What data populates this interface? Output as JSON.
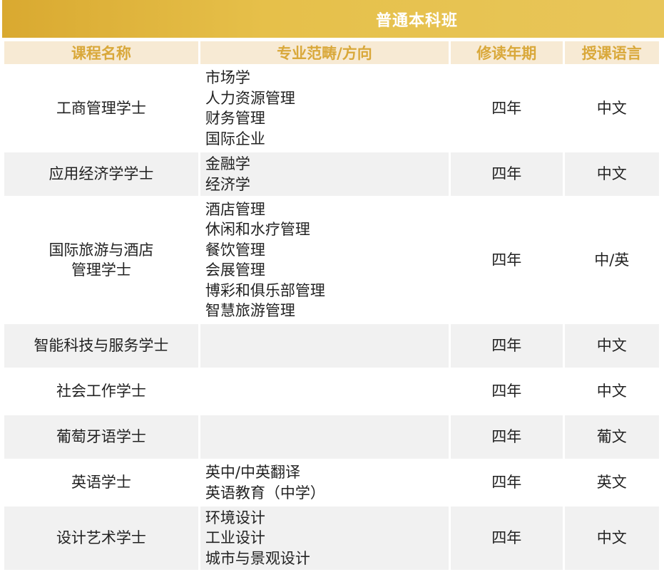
{
  "banner": {
    "title": "普通本科班"
  },
  "headers": [
    "课程名称",
    "专业范畴/方向",
    "修读年期",
    "授课语言"
  ],
  "rows": [
    {
      "name": "工商管理学士",
      "specs": [
        "市场学",
        "人力资源管理",
        "财务管理",
        "国际企业"
      ],
      "duration": "四年",
      "language": "中文"
    },
    {
      "name": "应用经济学学士",
      "specs": [
        "金融学",
        "经济学"
      ],
      "duration": "四年",
      "language": "中文"
    },
    {
      "name_lines": [
        "国际旅游与酒店",
        "管理学士"
      ],
      "specs": [
        "酒店管理",
        "休闲和水疗管理",
        "餐饮管理",
        "会展管理",
        "博彩和俱乐部管理",
        "智慧旅游管理"
      ],
      "duration": "四年",
      "language": "中/英"
    },
    {
      "name": "智能科技与服务学士",
      "specs": [],
      "duration": "四年",
      "language": "中文"
    },
    {
      "name": "社会工作学士",
      "specs": [],
      "duration": "四年",
      "language": "中文"
    },
    {
      "name": "葡萄牙语学士",
      "specs": [],
      "duration": "四年",
      "language": "葡文"
    },
    {
      "name": "英语学士",
      "specs": [
        "英中/中英翻译",
        "英语教育（中学）"
      ],
      "duration": "四年",
      "language": "英文"
    },
    {
      "name": "设计艺术学士",
      "specs": [
        "环境设计",
        "工业设计",
        "城市与景观设计"
      ],
      "duration": "四年",
      "language": "中文"
    }
  ]
}
